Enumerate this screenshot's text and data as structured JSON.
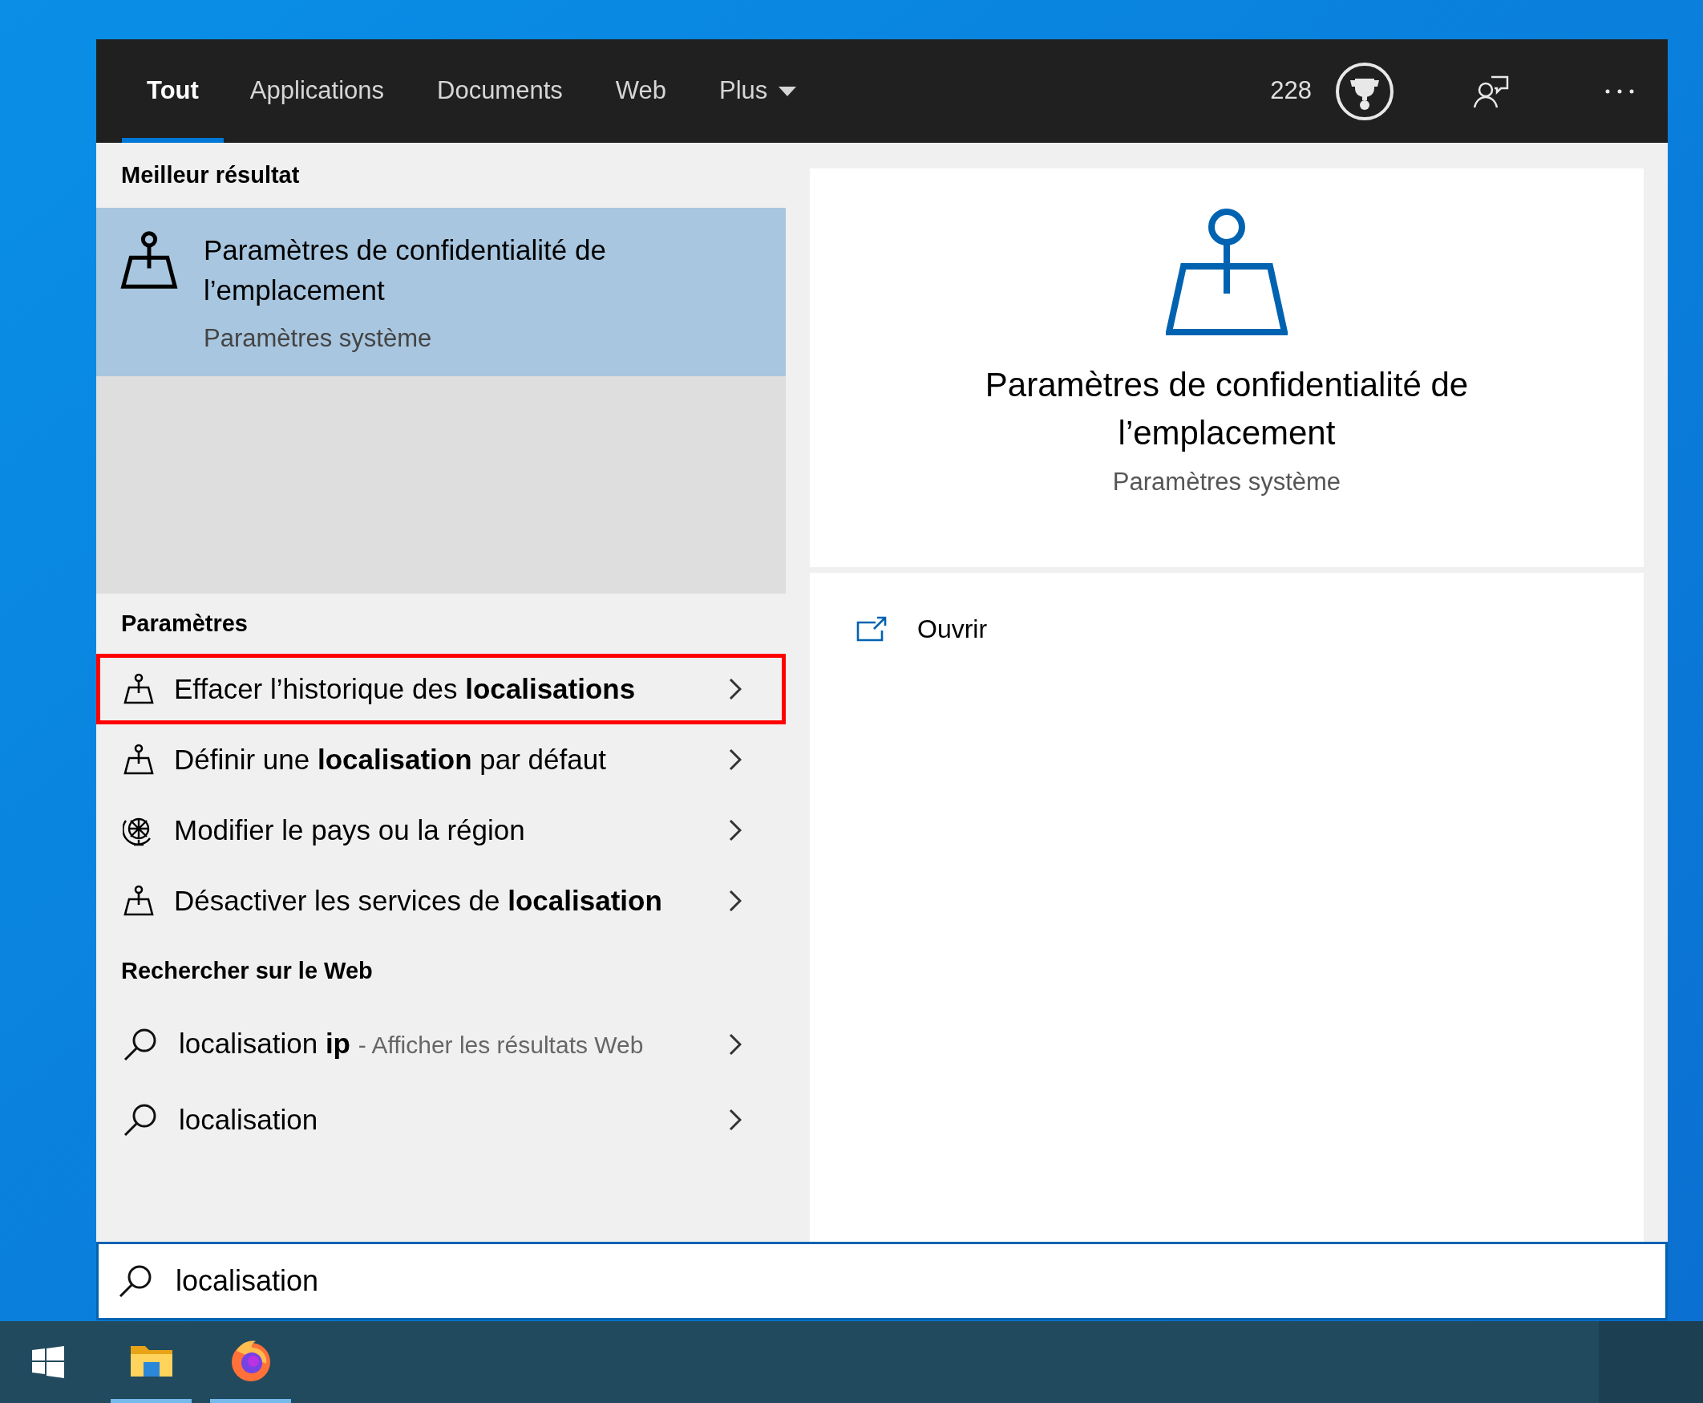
{
  "tabs": [
    {
      "label": "Tout",
      "selected": true,
      "kind": "plain"
    },
    {
      "label": "Applications",
      "selected": false,
      "kind": "plain"
    },
    {
      "label": "Documents",
      "selected": false,
      "kind": "plain"
    },
    {
      "label": "Web",
      "selected": false,
      "kind": "plain"
    },
    {
      "label": "Plus",
      "selected": false,
      "kind": "dropdown"
    }
  ],
  "points": "228",
  "best_result": {
    "header": "Meilleur résultat",
    "title": "Paramètres de confidentialité de l’emplacement",
    "subtitle": "Paramètres système",
    "selected": true
  },
  "settings": {
    "header": "Paramètres",
    "items": [
      {
        "text": "Effacer l’historique des **localisations**",
        "kind": "location",
        "highlighted": true
      },
      {
        "text": "Définir une **localisation** par défaut",
        "kind": "location",
        "highlighted": false
      },
      {
        "text": "Modifier le pays ou la région",
        "kind": "region",
        "highlighted": false
      },
      {
        "text": "Désactiver les services de **localisation**",
        "kind": "location",
        "highlighted": false
      }
    ]
  },
  "web": {
    "header": "Rechercher sur le Web",
    "items": [
      {
        "query": "localisation **ip**",
        "hint": "- Afficher les résultats Web"
      },
      {
        "query": "localisation"
      }
    ]
  },
  "preview": {
    "title": "Paramètres de confidentialité de l’emplacement",
    "subtitle": "Paramètres système",
    "actions": [
      {
        "label": "Ouvrir"
      }
    ]
  },
  "search": {
    "value": "localisation"
  },
  "taskbar": {
    "apps": [
      {
        "kind": "folder",
        "running": true
      },
      {
        "kind": "browser",
        "running": true
      }
    ]
  }
}
